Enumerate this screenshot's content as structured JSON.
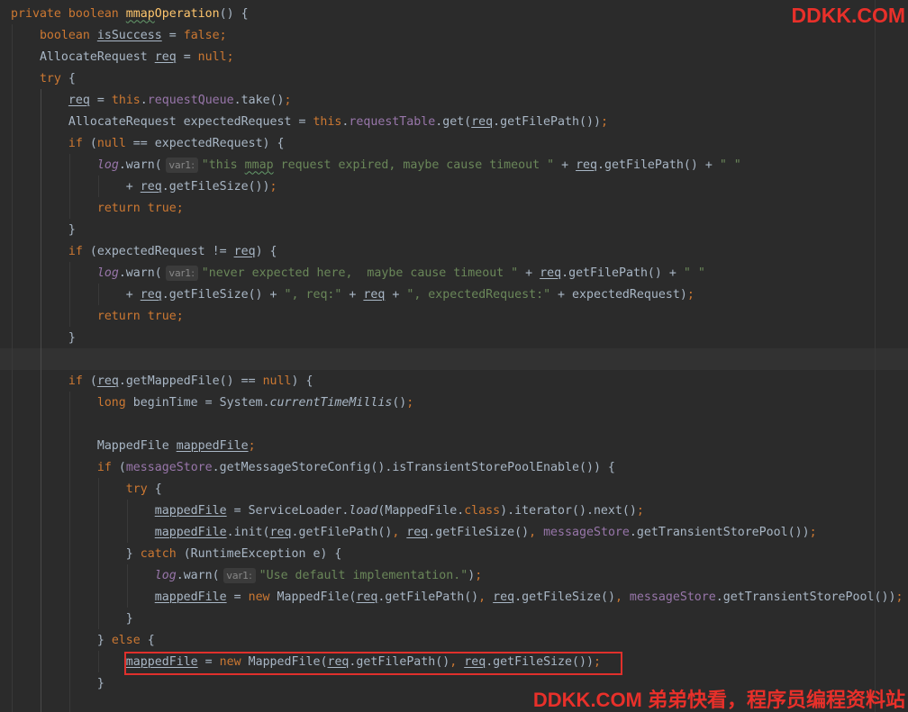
{
  "editor": {
    "theme": {
      "background": "#2b2b2b",
      "current_line": "#323232",
      "default_text": "#a9b7c6",
      "keyword": "#cc7832",
      "method_declaration": "#ffc66d",
      "field": "#9876aa",
      "string": "#6a8759",
      "parameter_hint_text": "#878787",
      "parameter_hint_background": "#3b3b3b",
      "indent_guide": "#393939",
      "indent_guide_active": "#4a4a4a",
      "right_margin": "#383838",
      "typo": "#659c6b",
      "highlight_box": "#e0302c",
      "watermark": "#e8302a"
    },
    "lines": [
      [
        [
          "private boolean ",
          "keyword"
        ],
        [
          "mmap",
          "method+typo"
        ],
        [
          "Operation",
          "method"
        ],
        [
          "() {",
          "text"
        ]
      ],
      [
        [
          "    boolean ",
          "keyword"
        ],
        [
          "isSuccess",
          "variable"
        ],
        [
          " = ",
          "text"
        ],
        [
          "false;",
          "keyword"
        ]
      ],
      [
        [
          "    AllocateRequest ",
          "text"
        ],
        [
          "req",
          "variable"
        ],
        [
          " = ",
          "text"
        ],
        [
          "null;",
          "keyword"
        ]
      ],
      [
        [
          "    try ",
          "keyword"
        ],
        [
          "{",
          "text"
        ]
      ],
      [
        [
          "        ",
          "indent"
        ],
        [
          "req",
          "variable"
        ],
        [
          " = ",
          "text"
        ],
        [
          "this",
          "keyword"
        ],
        [
          ".",
          "text"
        ],
        [
          "requestQueue",
          "field"
        ],
        [
          ".take()",
          "text"
        ],
        [
          ";",
          "keyword"
        ]
      ],
      [
        [
          "        AllocateRequest expectedRequest = ",
          "text"
        ],
        [
          "this",
          "keyword"
        ],
        [
          ".",
          "text"
        ],
        [
          "requestTable",
          "field"
        ],
        [
          ".get(",
          "text"
        ],
        [
          "req",
          "variable"
        ],
        [
          ".getFilePath())",
          "text"
        ],
        [
          ";",
          "keyword"
        ]
      ],
      [
        [
          "        if ",
          "keyword"
        ],
        [
          "(",
          "text"
        ],
        [
          "null",
          "keyword"
        ],
        [
          " == expectedRequest) {",
          "text"
        ]
      ],
      [
        [
          "            ",
          "indent"
        ],
        [
          "log",
          "static-field"
        ],
        [
          ".warn(",
          "text"
        ],
        [
          "var1:",
          "hint"
        ],
        [
          "\"this ",
          "string"
        ],
        [
          "mmap",
          "string+typo"
        ],
        [
          " request expired, maybe cause timeout \"",
          "string"
        ],
        [
          " + ",
          "text"
        ],
        [
          "req",
          "variable"
        ],
        [
          ".getFilePath() + ",
          "text"
        ],
        [
          "\" \"",
          "string"
        ]
      ],
      [
        [
          "                + ",
          "text"
        ],
        [
          "req",
          "variable"
        ],
        [
          ".getFileSize())",
          "text"
        ],
        [
          ";",
          "keyword"
        ]
      ],
      [
        [
          "            return true;",
          "keyword"
        ]
      ],
      [
        [
          "        }",
          "text"
        ]
      ],
      [
        [
          "        if ",
          "keyword"
        ],
        [
          "(expectedRequest != ",
          "text"
        ],
        [
          "req",
          "variable"
        ],
        [
          ") {",
          "text"
        ]
      ],
      [
        [
          "            ",
          "indent"
        ],
        [
          "log",
          "static-field"
        ],
        [
          ".warn(",
          "text"
        ],
        [
          "var1:",
          "hint"
        ],
        [
          "\"never expected here,  maybe cause timeout \"",
          "string"
        ],
        [
          " + ",
          "text"
        ],
        [
          "req",
          "variable"
        ],
        [
          ".getFilePath() + ",
          "text"
        ],
        [
          "\" \"",
          "string"
        ]
      ],
      [
        [
          "                + ",
          "text"
        ],
        [
          "req",
          "variable"
        ],
        [
          ".getFileSize() + ",
          "text"
        ],
        [
          "\", req:\"",
          "string"
        ],
        [
          " + ",
          "text"
        ],
        [
          "req",
          "variable"
        ],
        [
          " + ",
          "text"
        ],
        [
          "\", expectedRequest:\"",
          "string"
        ],
        [
          " + expectedRequest)",
          "text"
        ],
        [
          ";",
          "keyword"
        ]
      ],
      [
        [
          "            return true;",
          "keyword"
        ]
      ],
      [
        [
          "        }",
          "text"
        ]
      ],
      [],
      [
        [
          "        if ",
          "keyword"
        ],
        [
          "(",
          "text"
        ],
        [
          "req",
          "variable"
        ],
        [
          ".getMappedFile() == ",
          "text"
        ],
        [
          "null",
          "keyword"
        ],
        [
          ") {",
          "text"
        ]
      ],
      [
        [
          "            long ",
          "keyword"
        ],
        [
          "beginTime = System.",
          "text"
        ],
        [
          "currentTimeMillis",
          "static-call"
        ],
        [
          "()",
          "text"
        ],
        [
          ";",
          "keyword"
        ]
      ],
      [],
      [
        [
          "            MappedFile ",
          "text"
        ],
        [
          "mappedFile",
          "variable"
        ],
        [
          ";",
          "keyword"
        ]
      ],
      [
        [
          "            if ",
          "keyword"
        ],
        [
          "(",
          "text"
        ],
        [
          "messageStore",
          "field"
        ],
        [
          ".getMessageStoreConfig().isTransientStorePoolEnable()) {",
          "text"
        ]
      ],
      [
        [
          "                try ",
          "keyword"
        ],
        [
          "{",
          "text"
        ]
      ],
      [
        [
          "                    ",
          "indent"
        ],
        [
          "mappedFile",
          "variable"
        ],
        [
          " = ServiceLoader.",
          "text"
        ],
        [
          "load",
          "static-call"
        ],
        [
          "(MappedFile.",
          "text"
        ],
        [
          "class",
          "keyword"
        ],
        [
          ").iterator().next()",
          "text"
        ],
        [
          ";",
          "keyword"
        ]
      ],
      [
        [
          "                    ",
          "indent"
        ],
        [
          "mappedFile",
          "variable"
        ],
        [
          ".init(",
          "text"
        ],
        [
          "req",
          "variable"
        ],
        [
          ".getFilePath()",
          "text"
        ],
        [
          ", ",
          "keyword"
        ],
        [
          "req",
          "variable"
        ],
        [
          ".getFileSize()",
          "text"
        ],
        [
          ", ",
          "keyword"
        ],
        [
          "messageStore",
          "field"
        ],
        [
          ".getTransientStorePool())",
          "text"
        ],
        [
          ";",
          "keyword"
        ]
      ],
      [
        [
          "                } ",
          "text"
        ],
        [
          "catch ",
          "keyword"
        ],
        [
          "(RuntimeException e) {",
          "text"
        ]
      ],
      [
        [
          "                    ",
          "indent"
        ],
        [
          "log",
          "static-field"
        ],
        [
          ".warn(",
          "text"
        ],
        [
          "var1:",
          "hint"
        ],
        [
          "\"Use default implementation.\"",
          "string"
        ],
        [
          ")",
          "text"
        ],
        [
          ";",
          "keyword"
        ]
      ],
      [
        [
          "                    ",
          "indent"
        ],
        [
          "mappedFile",
          "variable"
        ],
        [
          " = ",
          "text"
        ],
        [
          "new ",
          "keyword"
        ],
        [
          "MappedFile(",
          "text"
        ],
        [
          "req",
          "variable"
        ],
        [
          ".getFilePath()",
          "text"
        ],
        [
          ", ",
          "keyword"
        ],
        [
          "req",
          "variable"
        ],
        [
          ".getFileSize()",
          "text"
        ],
        [
          ", ",
          "keyword"
        ],
        [
          "messageStore",
          "field"
        ],
        [
          ".getTransientStorePool())",
          "text"
        ],
        [
          ";",
          "keyword"
        ]
      ],
      [
        [
          "                }",
          "text"
        ]
      ],
      [
        [
          "            } ",
          "text"
        ],
        [
          "else ",
          "keyword"
        ],
        [
          "{",
          "text"
        ]
      ],
      [
        [
          "                ",
          "indent"
        ],
        [
          "mappedFile",
          "variable"
        ],
        [
          " = ",
          "text"
        ],
        [
          "new ",
          "keyword"
        ],
        [
          "MappedFile(",
          "text"
        ],
        [
          "req",
          "variable"
        ],
        [
          ".getFilePath()",
          "text"
        ],
        [
          ", ",
          "keyword"
        ],
        [
          "req",
          "variable"
        ],
        [
          ".getFileSize())",
          "text"
        ],
        [
          ";",
          "keyword"
        ]
      ],
      [
        [
          "            }",
          "text"
        ]
      ]
    ]
  },
  "watermark": {
    "top": "DDKK.COM",
    "bottom": "DDKK.COM 弟弟快看，程序员编程资料站"
  }
}
